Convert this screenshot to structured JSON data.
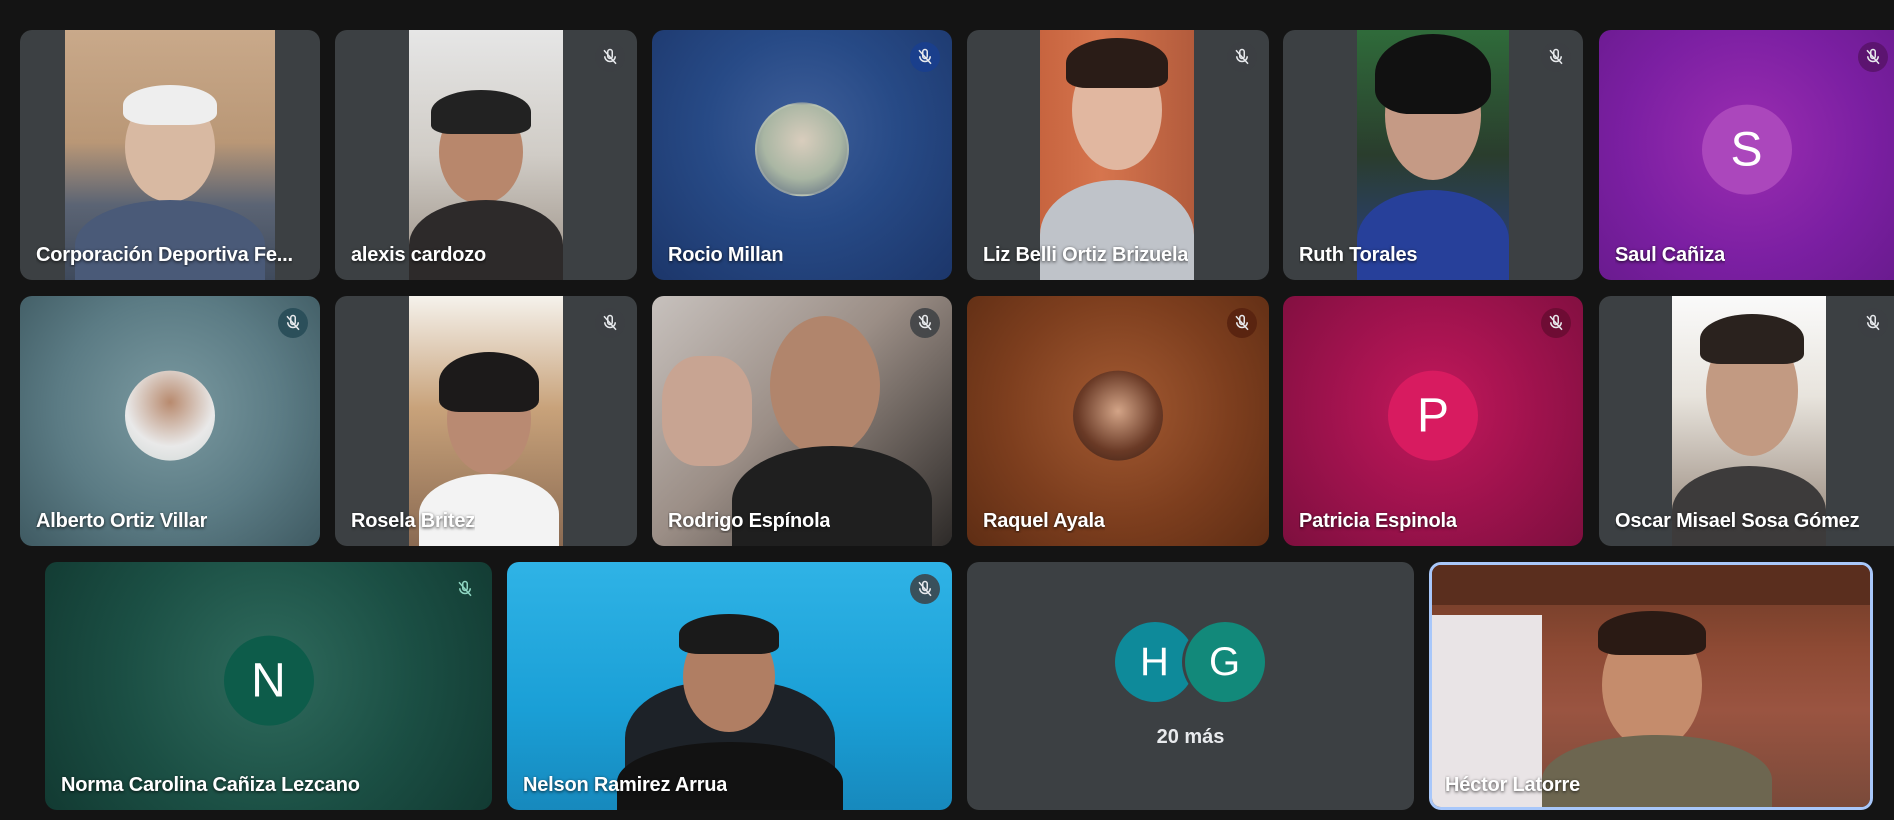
{
  "participants": [
    {
      "name": "Corporación Deportiva Fe...",
      "muted": false,
      "type": "video"
    },
    {
      "name": "alexis cardozo",
      "muted": true,
      "type": "video"
    },
    {
      "name": "Rocio Millan",
      "muted": true,
      "type": "avatar-photo"
    },
    {
      "name": "Liz Belli Ortiz Brizuela",
      "muted": true,
      "type": "video"
    },
    {
      "name": "Ruth Torales",
      "muted": true,
      "type": "video"
    },
    {
      "name": "Saul Cañiza",
      "muted": true,
      "type": "avatar-letter",
      "initial": "S"
    },
    {
      "name": "Alberto Ortiz Villar",
      "muted": true,
      "type": "avatar-photo"
    },
    {
      "name": "Rosela Britez",
      "muted": true,
      "type": "video"
    },
    {
      "name": "Rodrigo Espínola",
      "muted": true,
      "type": "video"
    },
    {
      "name": "Raquel Ayala",
      "muted": true,
      "type": "avatar-photo"
    },
    {
      "name": "Patricia Espinola",
      "muted": true,
      "type": "avatar-letter",
      "initial": "P"
    },
    {
      "name": "Oscar Misael Sosa Gómez",
      "muted": true,
      "type": "video"
    },
    {
      "name": "Norma Carolina Cañiza Lezcano",
      "muted": true,
      "type": "avatar-letter",
      "initial": "N"
    },
    {
      "name": "Nelson Ramirez Arrua",
      "muted": true,
      "type": "video"
    },
    {
      "name": "Héctor Latorre",
      "muted": false,
      "type": "video",
      "active_speaker": true
    }
  ],
  "overflow": {
    "initials": [
      "H",
      "G"
    ],
    "label": "20 más"
  },
  "icons": {
    "muted": "mic-off-icon"
  },
  "colors": {
    "background": "#141414",
    "tile": "#3c4043",
    "active_border": "#a8c7fa",
    "saul_bg": "#7b1fa2",
    "patricia_bg": "#c2185b",
    "norma_bg": "#0d5c4a",
    "h_avatar": "#0e8a9a",
    "g_avatar": "#12897a"
  }
}
